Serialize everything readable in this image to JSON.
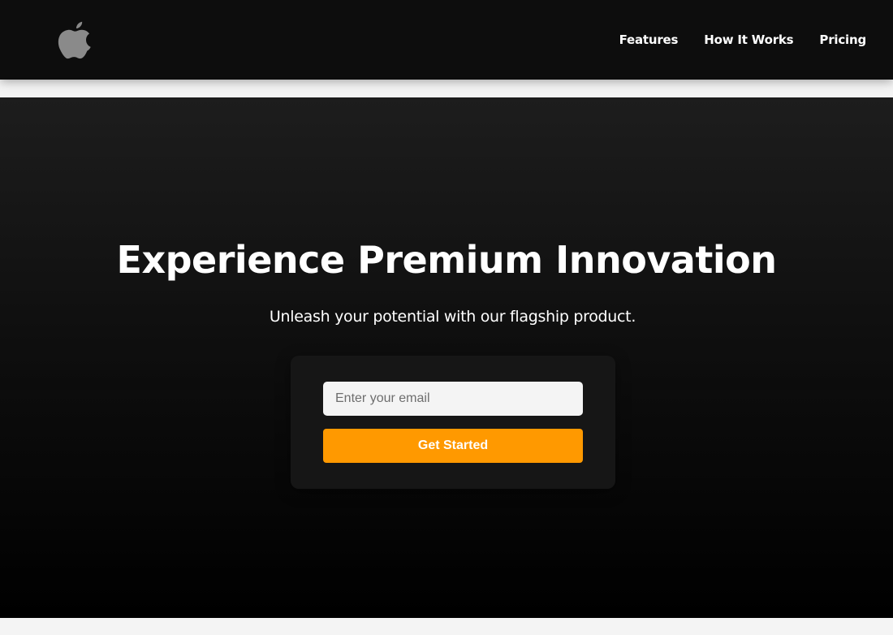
{
  "header": {
    "logo_icon": "apple-logo-icon",
    "nav": [
      {
        "label": "Features"
      },
      {
        "label": "How It Works"
      },
      {
        "label": "Pricing"
      }
    ]
  },
  "hero": {
    "title": "Experience Premium Innovation",
    "subtitle": "Unleash your potential with our flagship product.",
    "signup": {
      "email_placeholder": "Enter your email",
      "email_value": "",
      "button_label": "Get Started"
    }
  },
  "colors": {
    "navbar_bg": "#0d0d0d",
    "hero_gradient_top": "#1d1d1d",
    "hero_gradient_bottom": "#000000",
    "card_bg": "#161616",
    "accent": "#ff9900",
    "logo": "#8a8a8a",
    "text": "#ffffff",
    "page_bg": "#f4f4f4"
  }
}
